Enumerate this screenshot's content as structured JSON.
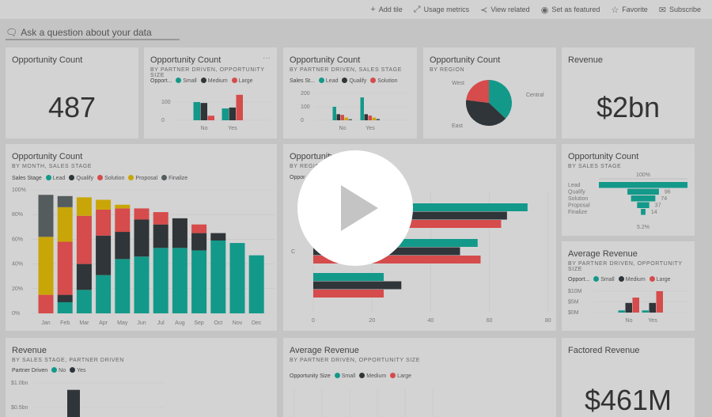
{
  "colors": {
    "teal": "#13998a",
    "dark": "#2f3538",
    "red": "#d64b4b",
    "yellow": "#c9a608",
    "grey": "#555c5e"
  },
  "toolbar": [
    {
      "icon": "plus-icon",
      "glyph": "+",
      "label": "Add tile"
    },
    {
      "icon": "usage-metrics-icon",
      "glyph": "⤢",
      "label": "Usage metrics"
    },
    {
      "icon": "share-related-icon",
      "glyph": "≺",
      "label": "View related"
    },
    {
      "icon": "featured-icon",
      "glyph": "◉",
      "label": "Set as featured"
    },
    {
      "icon": "star-icon",
      "glyph": "☆",
      "label": "Favorite"
    },
    {
      "icon": "mail-icon",
      "glyph": "✉",
      "label": "Subscribe"
    }
  ],
  "qa": {
    "placeholder": "Ask a question about your data"
  },
  "tiles": {
    "count": {
      "title": "Opportunity Count",
      "value": "487"
    },
    "partner_size": {
      "title": "Opportunity Count",
      "subtitle": "BY PARTNER DRIVEN, OPPORTUNITY SIZE",
      "legend_title": "Opport...",
      "more": "···"
    },
    "partner_stage": {
      "title": "Opportunity Count",
      "subtitle": "BY PARTNER DRIVEN, SALES STAGE",
      "legend_title": "Sales St..."
    },
    "region": {
      "title": "Opportunity Count",
      "subtitle": "BY REGION"
    },
    "revenue": {
      "title": "Revenue",
      "value": "$2bn"
    },
    "month": {
      "title": "Opportunity Count",
      "subtitle": "BY MONTH, SALES STAGE",
      "legend_title": "Sales Stage"
    },
    "region_stage": {
      "title": "Opportunity Count",
      "subtitle": "BY REGION",
      "legend_title": "Oppor",
      "cat_label": "C"
    },
    "funnel": {
      "title": "Opportunity Count",
      "subtitle": "BY SALES STAGE"
    },
    "avg_rev": {
      "title": "Average Revenue",
      "subtitle": "BY PARTNER DRIVEN, OPPORTUNITY SIZE",
      "legend_title": "Opport..."
    },
    "rev_stage": {
      "title": "Revenue",
      "subtitle": "BY SALES STAGE, PARTNER DRIVEN",
      "legend_title": "Partner Driven"
    },
    "avg_rev2": {
      "title": "Average Revenue",
      "subtitle": "BY PARTNER DRIVEN, OPPORTUNITY SIZE",
      "legend_title": "Opportunity Size"
    },
    "factored": {
      "title": "Factored Revenue",
      "value": "$461M"
    }
  },
  "chart_data": [
    {
      "id": "partner_size",
      "type": "bar",
      "categories": [
        "No",
        "Yes"
      ],
      "series": [
        {
          "name": "Small",
          "values": [
            100,
            65
          ]
        },
        {
          "name": "Medium",
          "values": [
            95,
            70
          ]
        },
        {
          "name": "Large",
          "values": [
            25,
            140
          ]
        }
      ],
      "yticks": [
        "0",
        "100"
      ],
      "ylim": [
        0,
        150
      ]
    },
    {
      "id": "partner_stage",
      "type": "bar",
      "categories": [
        "No",
        "Yes"
      ],
      "series": [
        {
          "name": "Lead",
          "values": [
            100,
            170
          ]
        },
        {
          "name": "Qualify",
          "values": [
            45,
            45
          ]
        },
        {
          "name": "Solution",
          "values": [
            40,
            35
          ]
        },
        {
          "name": "Proposal",
          "values": [
            20,
            20
          ]
        },
        {
          "name": "Finalize",
          "values": [
            8,
            10
          ]
        }
      ],
      "yticks": [
        "0",
        "100",
        "200"
      ],
      "ylim": [
        0,
        200
      ]
    },
    {
      "id": "region",
      "type": "pie",
      "labels": [
        "Central",
        "East",
        "West"
      ],
      "values": [
        37,
        40,
        23
      ]
    },
    {
      "id": "month",
      "type": "bar",
      "stacked": true,
      "categories": [
        "Jan",
        "Feb",
        "Mar",
        "Apr",
        "May",
        "Jun",
        "Jul",
        "Aug",
        "Sep",
        "Oct",
        "Nov",
        "Dec"
      ],
      "series": [
        {
          "name": "Lead",
          "values": [
            0,
            9,
            19,
            31,
            44,
            46,
            53,
            53,
            51,
            59,
            57,
            47
          ]
        },
        {
          "name": "Qualify",
          "values": [
            0,
            6,
            21,
            32,
            22,
            30,
            19,
            24,
            14,
            6,
            0,
            0
          ]
        },
        {
          "name": "Solution",
          "values": [
            15,
            43,
            39,
            21,
            19,
            9,
            10,
            0,
            7,
            0,
            0,
            0
          ]
        },
        {
          "name": "Proposal",
          "values": [
            47,
            28,
            15,
            8,
            3,
            0,
            0,
            0,
            0,
            0,
            0,
            0
          ]
        },
        {
          "name": "Finalize",
          "values": [
            34,
            9,
            0,
            0,
            0,
            0,
            0,
            0,
            0,
            0,
            0,
            0
          ]
        }
      ],
      "yticks": [
        "0%",
        "20%",
        "40%",
        "60%",
        "80%",
        "100%"
      ],
      "ylim": [
        0,
        100
      ]
    },
    {
      "id": "region_stage",
      "type": "bar",
      "orientation": "horizontal",
      "series": [
        {
          "values": [
            73,
            56,
            24
          ]
        },
        {
          "values": [
            66,
            50,
            30
          ]
        },
        {
          "values": [
            64,
            57,
            24
          ]
        }
      ],
      "xticks": [
        "0",
        "20",
        "40",
        "60",
        "80"
      ],
      "xlim": [
        0,
        80
      ]
    },
    {
      "id": "funnel",
      "type": "funnel",
      "categories": [
        "Lead",
        "Qualify",
        "Solution",
        "Proposal",
        "Finalize"
      ],
      "values": [
        270,
        96,
        74,
        37,
        14
      ],
      "value_labels": [
        "",
        "96",
        "74",
        "37",
        "14"
      ],
      "top_label": "100%",
      "bottom_label": "5.2%"
    },
    {
      "id": "avg_rev",
      "type": "bar",
      "categories": [
        "No",
        "Yes"
      ],
      "series": [
        {
          "name": "Small",
          "values": [
            1,
            1
          ]
        },
        {
          "name": "Medium",
          "values": [
            4.5,
            4.5
          ]
        },
        {
          "name": "Large",
          "values": [
            7,
            10
          ]
        }
      ],
      "yticks": [
        "$0M",
        "$5M",
        "$10M"
      ],
      "ylim": [
        0,
        10
      ]
    },
    {
      "id": "rev_stage",
      "type": "bar",
      "series": [
        {
          "name": "No",
          "values": []
        },
        {
          "name": "Yes",
          "values": [
            0.86
          ]
        }
      ],
      "yticks": [
        "$0.5bn",
        "$1.0bn"
      ]
    },
    {
      "id": "avg_rev2",
      "type": "bar",
      "series": [
        {
          "name": "Small"
        },
        {
          "name": "Medium"
        },
        {
          "name": "Large"
        }
      ]
    }
  ],
  "video": {
    "icon": "play-icon"
  }
}
